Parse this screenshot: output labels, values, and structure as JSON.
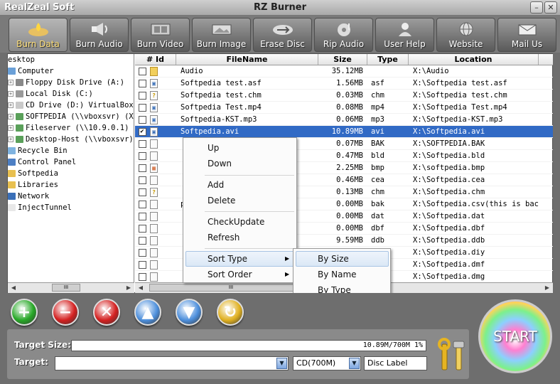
{
  "window": {
    "app_name": "RealZeal Soft",
    "title": "RZ Burner"
  },
  "toolbar": [
    {
      "label": "Burn Data",
      "icon": "flame-disc-icon",
      "active": true
    },
    {
      "label": "Burn Audio",
      "icon": "speaker-icon"
    },
    {
      "label": "Burn Video",
      "icon": "film-icon"
    },
    {
      "label": "Burn Image",
      "icon": "image-disc-icon"
    },
    {
      "label": "Erase Disc",
      "icon": "eraser-icon"
    },
    {
      "label": "Rip Audio",
      "icon": "music-disc-icon"
    },
    {
      "label": "User Help",
      "icon": "user-help-icon"
    },
    {
      "label": "Website",
      "icon": "globe-icon"
    },
    {
      "label": "Mail Us",
      "icon": "mail-icon"
    }
  ],
  "tree": [
    {
      "label": "esktop",
      "pm": "",
      "icon_color": ""
    },
    {
      "label": "Computer",
      "pm": "",
      "icon_color": "#6aa0d8"
    },
    {
      "label": "Floppy Disk Drive (A:)",
      "pm": "+",
      "icon_color": "#888888"
    },
    {
      "label": "Local Disk (C:)",
      "pm": "+",
      "icon_color": "#9a9a9a"
    },
    {
      "label": "CD Drive (D:) VirtualBox",
      "pm": "+",
      "icon_color": "#c9c9c9"
    },
    {
      "label": "SOFTPEDIA (\\\\vboxsvr) (X",
      "pm": "+",
      "icon_color": "#5aa05a"
    },
    {
      "label": "Fileserver (\\\\10.9.0.1)",
      "pm": "+",
      "icon_color": "#5aa05a"
    },
    {
      "label": "Desktop-Host (\\\\vboxsvr)",
      "pm": "+",
      "icon_color": "#5aa05a"
    },
    {
      "label": "Recycle Bin",
      "pm": "",
      "icon_color": "#7fb3e0"
    },
    {
      "label": "Control Panel",
      "pm": "",
      "icon_color": "#4d7fc4"
    },
    {
      "label": "Softpedia",
      "pm": "",
      "icon_color": "#e8c050"
    },
    {
      "label": "Libraries",
      "pm": "",
      "icon_color": "#e8c050"
    },
    {
      "label": "Network",
      "pm": "",
      "icon_color": "#3a6fb8"
    },
    {
      "label": "InjectTunnel",
      "pm": "",
      "icon_color": "#e8e8e8"
    }
  ],
  "columns": {
    "id": "# Id",
    "name": "FileName",
    "size": "Size",
    "type": "Type",
    "location": "Location"
  },
  "rows": [
    {
      "name": "Audio",
      "size": "35.12MB",
      "type": "",
      "loc": "X:\\Audio",
      "checked": false,
      "icon": "folder"
    },
    {
      "name": "Softpedia test.asf",
      "size": "1.56MB",
      "type": "asf",
      "loc": "X:\\Softpedia test.asf",
      "checked": false,
      "icon": "media"
    },
    {
      "name": "Softpedia test.chm",
      "size": "0.03MB",
      "type": "chm",
      "loc": "X:\\Softpedia test.chm",
      "checked": false,
      "icon": "help"
    },
    {
      "name": "Softpedia Test.mp4",
      "size": "0.08MB",
      "type": "mp4",
      "loc": "X:\\Softpedia Test.mp4",
      "checked": false,
      "icon": "media"
    },
    {
      "name": "Softpedia-KST.mp3",
      "size": "0.06MB",
      "type": "mp3",
      "loc": "X:\\Softpedia-KST.mp3",
      "checked": false,
      "icon": "media"
    },
    {
      "name": "Softpedia.avi",
      "size": "10.89MB",
      "type": "avi",
      "loc": "X:\\Softpedia.avi",
      "checked": true,
      "selected": true,
      "icon": "media"
    },
    {
      "name": "",
      "size": "0.07MB",
      "type": "BAK",
      "loc": "X:\\SOFTPEDIA.BAK",
      "checked": false,
      "icon": "doc"
    },
    {
      "name": "",
      "size": "0.47MB",
      "type": "bld",
      "loc": "X:\\Softpedia.bld",
      "checked": false,
      "icon": "doc"
    },
    {
      "name": "",
      "size": "2.25MB",
      "type": "bmp",
      "loc": "X:\\softpedia.bmp",
      "checked": false,
      "icon": "image"
    },
    {
      "name": "",
      "size": "0.46MB",
      "type": "cea",
      "loc": "X:\\Softpedia.cea",
      "checked": false,
      "icon": "doc"
    },
    {
      "name": "",
      "size": "0.13MB",
      "type": "chm",
      "loc": "X:\\Softpedia.chm",
      "checked": false,
      "icon": "help"
    },
    {
      "name": "p...",
      "size": "0.00MB",
      "type": "bak",
      "loc": "X:\\Softpedia.csv(this is bac...",
      "checked": false,
      "icon": "doc"
    },
    {
      "name": "",
      "size": "0.00MB",
      "type": "dat",
      "loc": "X:\\Softpedia.dat",
      "checked": false,
      "icon": "doc"
    },
    {
      "name": "",
      "size": "0.00MB",
      "type": "dbf",
      "loc": "X:\\Softpedia.dbf",
      "checked": false,
      "icon": "doc"
    },
    {
      "name": "",
      "size": "9.59MB",
      "type": "ddb",
      "loc": "X:\\Softpedia.ddb",
      "checked": false,
      "icon": "doc"
    },
    {
      "name": "",
      "size": "",
      "type": "",
      "loc": "X:\\Softpedia.diy",
      "checked": false,
      "icon": "doc"
    },
    {
      "name": "",
      "size": "",
      "type": "",
      "loc": "X:\\Softpedia.dmf",
      "checked": false,
      "icon": "doc"
    },
    {
      "name": "",
      "size": "",
      "type": "",
      "loc": "X:\\Softpedia.dmg",
      "checked": false,
      "icon": "doc"
    }
  ],
  "context_menu": {
    "up": "Up",
    "down": "Down",
    "add": "Add",
    "delete": "Delete",
    "check_update": "CheckUpdate",
    "refresh": "Refresh",
    "sort_type": "Sort Type",
    "sort_order": "Sort Order"
  },
  "submenu": {
    "by_size": "By Size",
    "by_name": "By Name",
    "by_type": "By Type"
  },
  "bottom": {
    "target_size_label": "Target Size:",
    "target_size_value": "10.89M/700M  1%",
    "target_label": "Target:",
    "target_value": "",
    "capacity": "CD(700M)",
    "disc_label": "Disc Label",
    "start": "START"
  },
  "action_buttons": [
    {
      "name": "add-button",
      "glyph": "+",
      "color": "#27a827"
    },
    {
      "name": "remove-button",
      "glyph": "−",
      "color": "#d42020"
    },
    {
      "name": "clear-button",
      "glyph": "✕",
      "color": "#d42020"
    },
    {
      "name": "move-up-button",
      "glyph": "▲",
      "color": "#4d8fdc"
    },
    {
      "name": "move-down-button",
      "glyph": "▼",
      "color": "#4d8fdc"
    },
    {
      "name": "refresh-button",
      "glyph": "↻",
      "color": "#e0b020"
    }
  ],
  "scroll": {
    "tree_thumb": "III",
    "list_thumb": "III"
  }
}
